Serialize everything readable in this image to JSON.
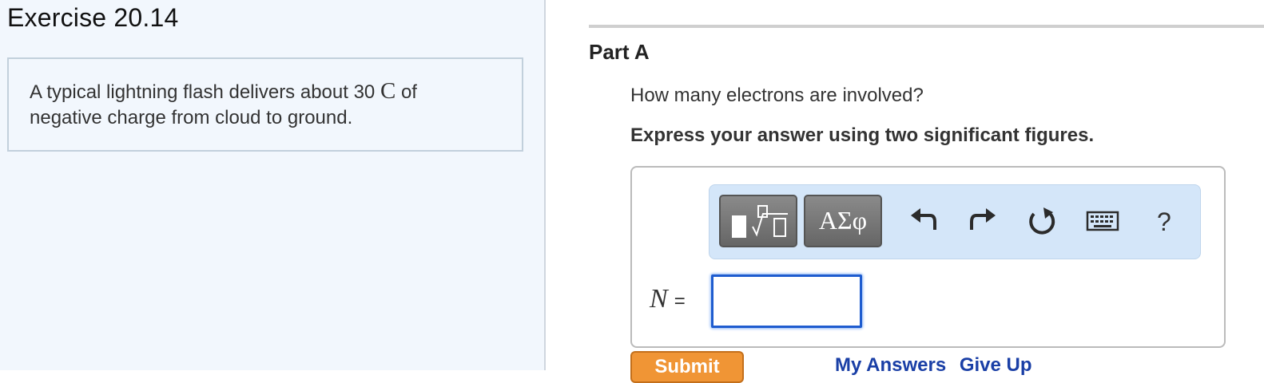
{
  "exercise": {
    "title": "Exercise 20.14"
  },
  "problem": {
    "text_before": "A typical lightning flash delivers about 30 ",
    "unit": "C",
    "text_after": " of negative charge from cloud to ground."
  },
  "part": {
    "title": "Part A",
    "question": "How many electrons are involved?",
    "instruction": "Express your answer using two significant figures."
  },
  "toolbar": {
    "greek_label": "ΑΣφ",
    "help_label": "?",
    "icons": [
      "templates-icon",
      "undo-icon",
      "redo-icon",
      "reset-icon",
      "keyboard-icon"
    ]
  },
  "answer": {
    "variable": "N",
    "equals": "=",
    "value": ""
  },
  "actions": {
    "submit_label": "Submit",
    "my_answers_label": "My Answers",
    "give_up_label": "Give Up"
  },
  "colors": {
    "left_pane_bg": "#f2f7fd",
    "toolbar_bg": "#d4e6f9",
    "input_border": "#1e5ccf",
    "submit_bg": "#f09535",
    "link": "#1a3fa6"
  }
}
